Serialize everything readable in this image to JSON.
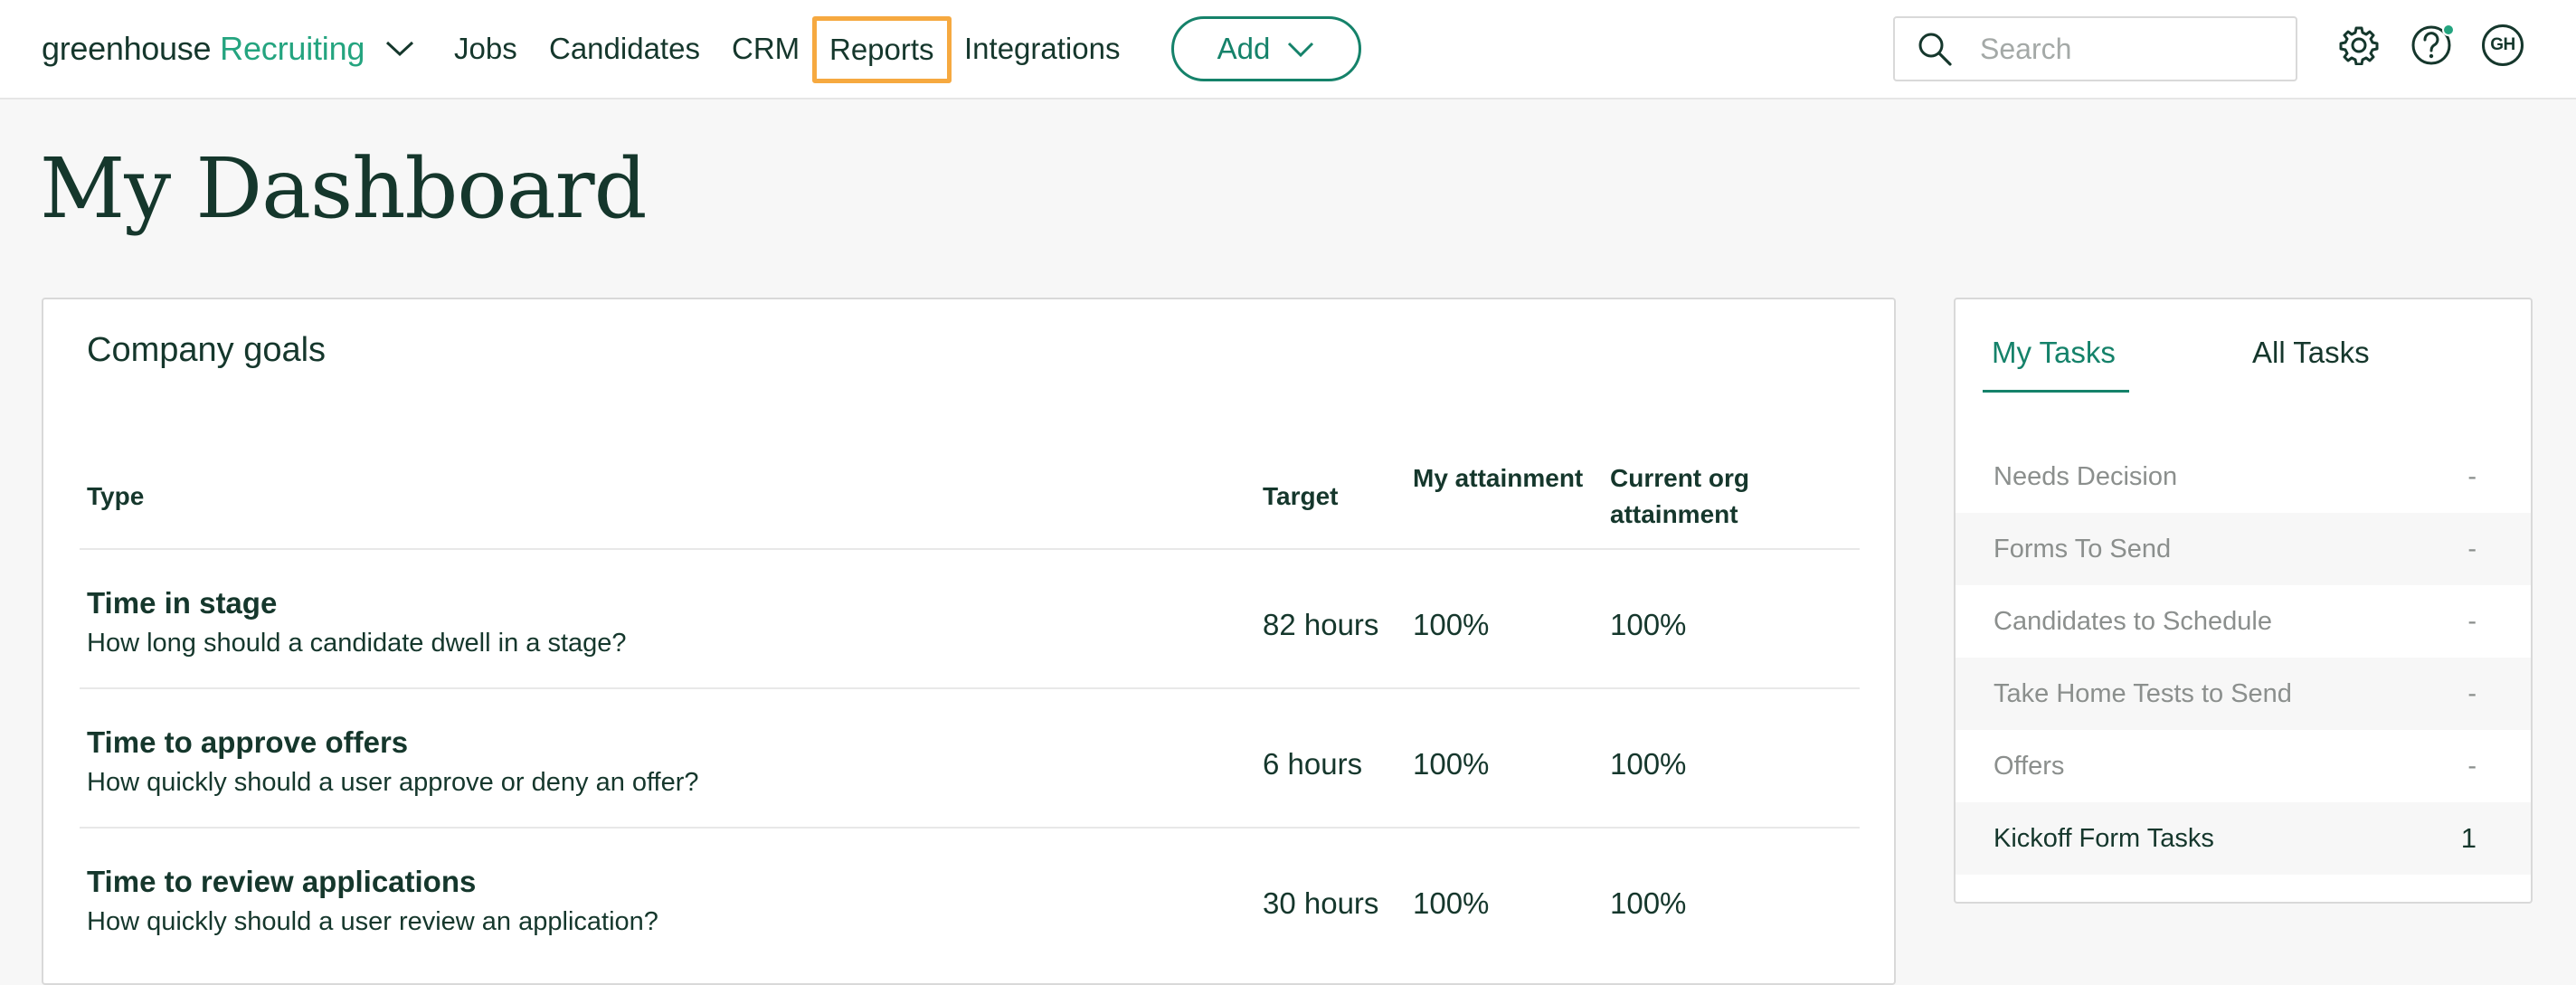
{
  "brand": {
    "logo_primary": "greenhouse",
    "logo_secondary": "Recruiting",
    "accent": "#24a47f",
    "dark": "#15372c",
    "button_green": "#15826a",
    "highlight": "#f6a940"
  },
  "nav": {
    "items": [
      {
        "label": "Jobs"
      },
      {
        "label": "Candidates"
      },
      {
        "label": "CRM"
      },
      {
        "label": "Reports"
      },
      {
        "label": "Integrations"
      }
    ],
    "add_label": "Add",
    "search_placeholder": "Search",
    "avatar_initials": "GH",
    "icons": [
      "chevron-down-icon",
      "search-icon",
      "gear-icon",
      "help-icon"
    ]
  },
  "page": {
    "title": "My Dashboard"
  },
  "goals": {
    "title": "Company goals",
    "columns": {
      "type": "Type",
      "target": "Target",
      "my_attainment": "My attainment",
      "org_attainment": "Current org attainment"
    },
    "rows": [
      {
        "name": "Time in stage",
        "description": "How long should a candidate dwell in a stage?",
        "target": "82 hours",
        "mine": "100%",
        "org": "100%"
      },
      {
        "name": "Time to approve offers",
        "description": "How quickly should a user approve or deny an offer?",
        "target": "6 hours",
        "mine": "100%",
        "org": "100%"
      },
      {
        "name": "Time to review applications",
        "description": "How quickly should a user review an application?",
        "target": "30 hours",
        "mine": "100%",
        "org": "100%"
      }
    ]
  },
  "tasks": {
    "tabs": [
      {
        "label": "My Tasks"
      },
      {
        "label": "All Tasks"
      }
    ],
    "items": [
      {
        "label": "Needs Decision",
        "count": "-"
      },
      {
        "label": "Forms To Send",
        "count": "-"
      },
      {
        "label": "Candidates to Schedule",
        "count": "-"
      },
      {
        "label": "Take Home Tests to Send",
        "count": "-"
      },
      {
        "label": "Offers",
        "count": "-"
      },
      {
        "label": "Kickoff Form Tasks",
        "count": "1"
      }
    ]
  }
}
